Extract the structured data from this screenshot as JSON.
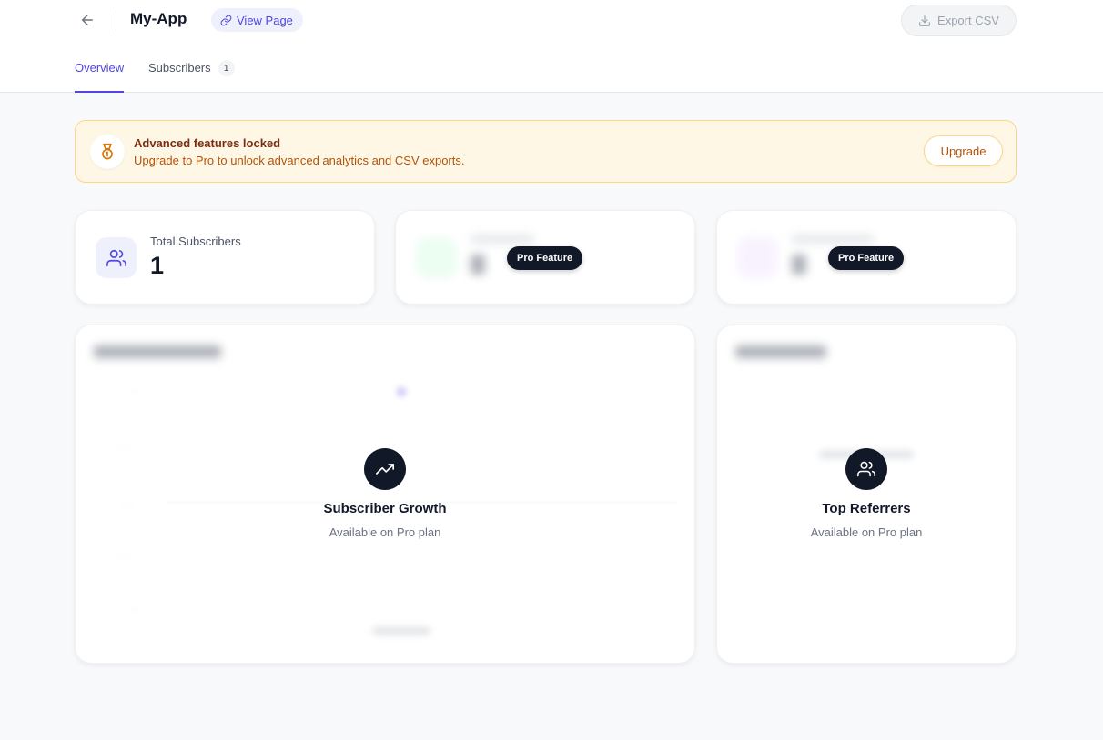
{
  "header": {
    "title": "My-App",
    "view_page_label": "View Page",
    "export_label": "Export CSV"
  },
  "tabs": {
    "overview": "Overview",
    "subscribers": "Subscribers",
    "subscribers_count": "1"
  },
  "banner": {
    "title": "Advanced features locked",
    "subtitle": "Upgrade to Pro to unlock advanced analytics and CSV exports.",
    "button": "Upgrade"
  },
  "stats": {
    "total_label": "Total Subscribers",
    "total_value": "1",
    "pro_label": "Pro Feature"
  },
  "growth": {
    "locked_title": "Subscriber Growth",
    "locked_sub": "Available on Pro plan"
  },
  "referrers": {
    "locked_title": "Top Referrers",
    "locked_sub": "Available on Pro plan"
  },
  "colors": {
    "accent": "#4f46e5",
    "warning_bg": "#fff7e6",
    "warning_border": "#fcd680",
    "dark": "#111827"
  },
  "icons": {
    "back": "arrow-left-icon",
    "link": "link-icon",
    "export": "download-icon",
    "banner": "medal-icon",
    "users": "users-icon",
    "trend": "trending-up-icon"
  }
}
